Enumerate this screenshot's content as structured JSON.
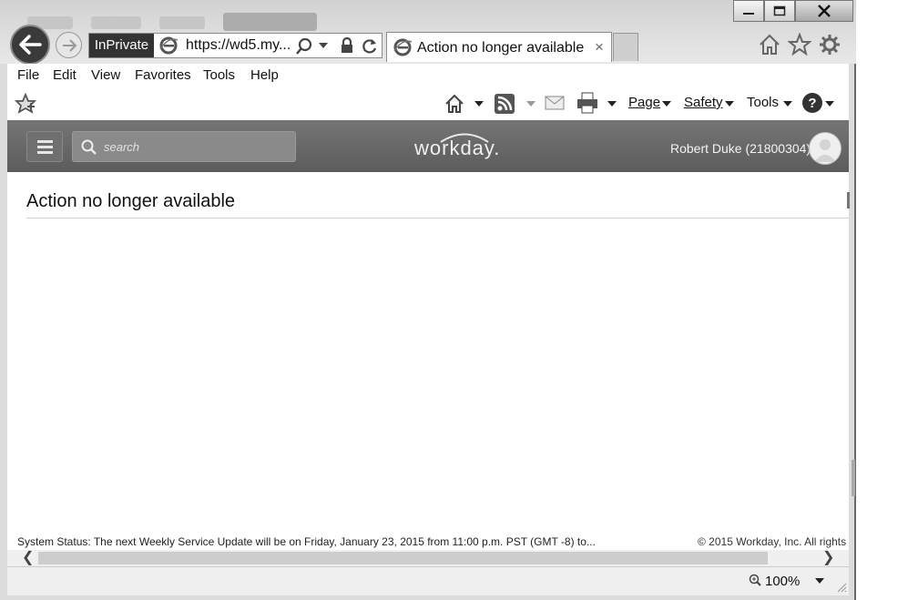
{
  "browser": {
    "inprivate_label": "InPrivate",
    "address": "https://wd5.my...",
    "tab_title": "Action no longer available",
    "tab_close": "×"
  },
  "menu": [
    "File",
    "Edit",
    "View",
    "Favorites",
    "Tools",
    "Help"
  ],
  "commandbar": {
    "page": "Page",
    "safety": "Safety",
    "tools": "Tools"
  },
  "workday": {
    "search_placeholder": "search",
    "logo": "workday.",
    "user": "Robert Duke (21800304)"
  },
  "content": {
    "heading": "Action no longer available"
  },
  "status": {
    "system_status": "System Status: The next Weekly Service Update will be on Friday, January 23, 2015 from 11:00 p.m. PST (GMT -8) to...",
    "copyright": "© 2015 Workday, Inc. All rights"
  },
  "statusbar": {
    "zoom": "100%"
  }
}
